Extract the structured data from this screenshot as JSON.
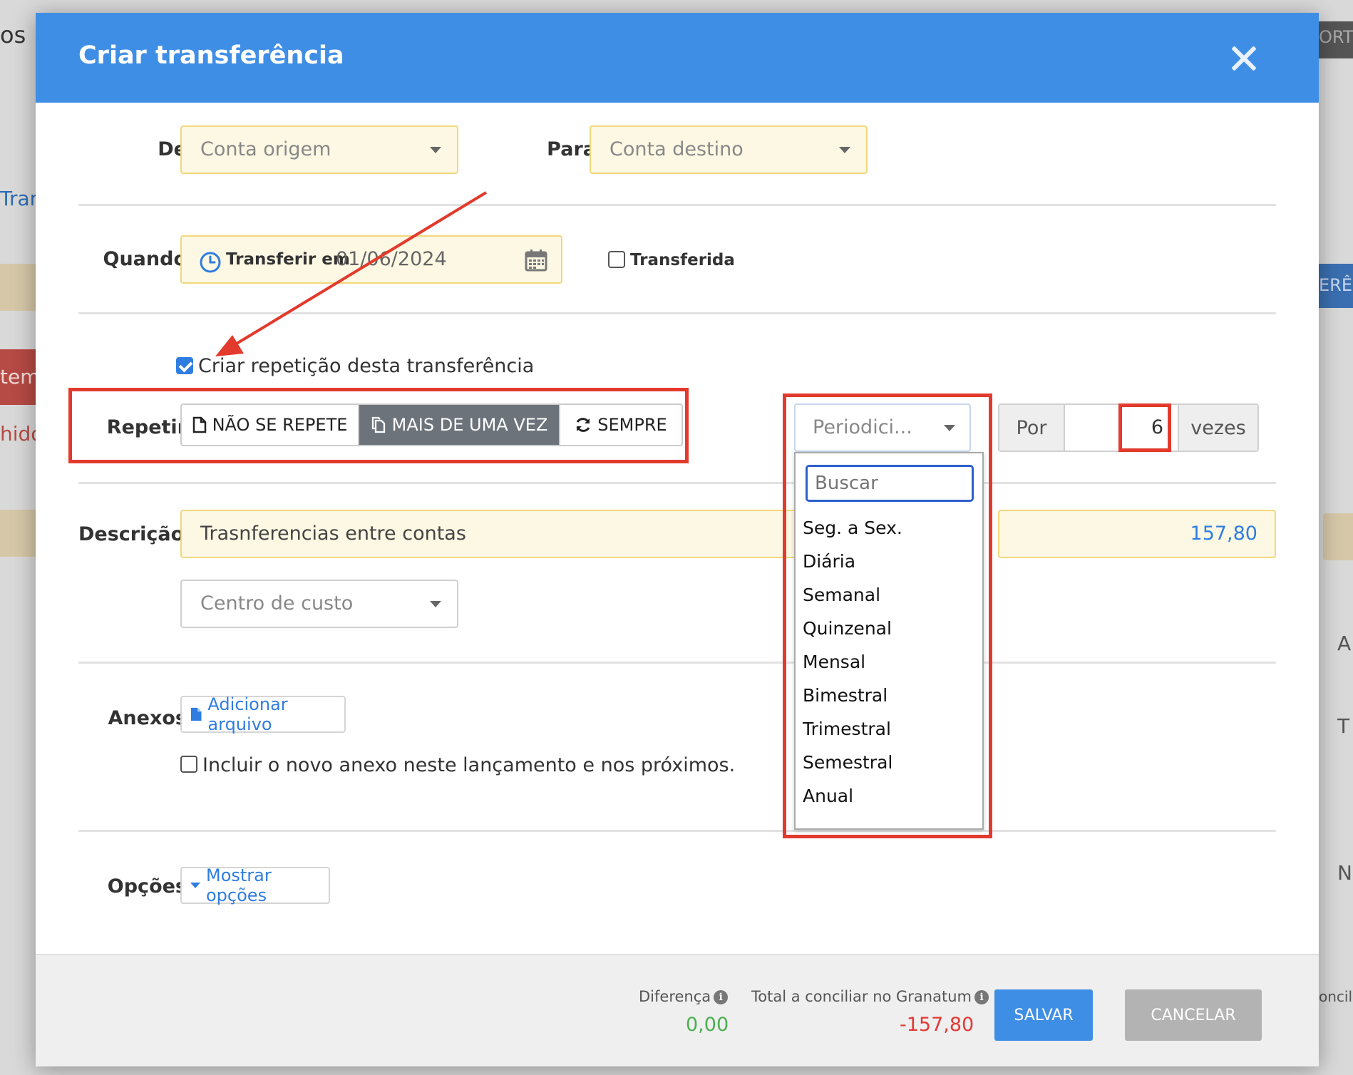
{
  "background": {
    "top_left_text": "os",
    "left_link_text": "Tran",
    "left_item_1": "tem",
    "left_item_2": "hido",
    "right_top_text": "ORT",
    "right_mid_text": "ERÊN",
    "right_item_a": "A",
    "right_item_t": "T",
    "right_item_n": "N",
    "right_bottom_text": "oncili"
  },
  "modal": {
    "title": "Criar transferência",
    "close_icon": "close-icon"
  },
  "form": {
    "from_label": "De",
    "from_placeholder": "Conta origem",
    "to_label": "Para",
    "to_placeholder": "Conta destino",
    "when_label": "Quando",
    "transfer_on_label": "Transferir em",
    "transfer_date": "01/06/2024",
    "transferred_label": "Transferida",
    "transferred_checked": false,
    "repeat_checkbox_label": "Criar repetição desta transferência",
    "repeat_checked": true,
    "repeat_label": "Repetir",
    "repeat_options": [
      {
        "label": "NÃO SE REPETE",
        "icon": "file-icon",
        "active": false
      },
      {
        "label": "MAIS DE UMA VEZ",
        "icon": "copy-icon",
        "active": true
      },
      {
        "label": "SEMPRE",
        "icon": "refresh-icon",
        "active": false
      }
    ],
    "periodicity_placeholder": "Periodici...",
    "periodicity_search_placeholder": "Buscar",
    "periodicity_options": [
      "Seg. a Sex.",
      "Diária",
      "Semanal",
      "Quinzenal",
      "Mensal",
      "Bimestral",
      "Trimestral",
      "Semestral",
      "Anual"
    ],
    "times_prefix": "Por",
    "times_value": "6",
    "times_suffix": "vezes",
    "description_label": "Descrição",
    "description_value": "Trasnferencias entre contas",
    "amount_value": "157,80",
    "cost_center_placeholder": "Centro de custo",
    "attachments_label": "Anexos",
    "add_file_label": "Adicionar arquivo",
    "include_attachment_label": "Incluir o novo anexo neste lançamento e nos próximos.",
    "include_attachment_checked": false,
    "options_label": "Opções",
    "show_options_label": "Mostrar opções"
  },
  "footer": {
    "difference_label": "Diferença",
    "difference_value": "0,00",
    "total_label": "Total a conciliar no Granatum",
    "total_value": "-157,80",
    "save_label": "SALVAR",
    "cancel_label": "CANCELAR"
  },
  "colors": {
    "header": "#3f8ee6",
    "accent": "#2f7de1",
    "annotation_red": "#e23a2c",
    "positive": "#4caf50",
    "negative": "#e53935"
  }
}
